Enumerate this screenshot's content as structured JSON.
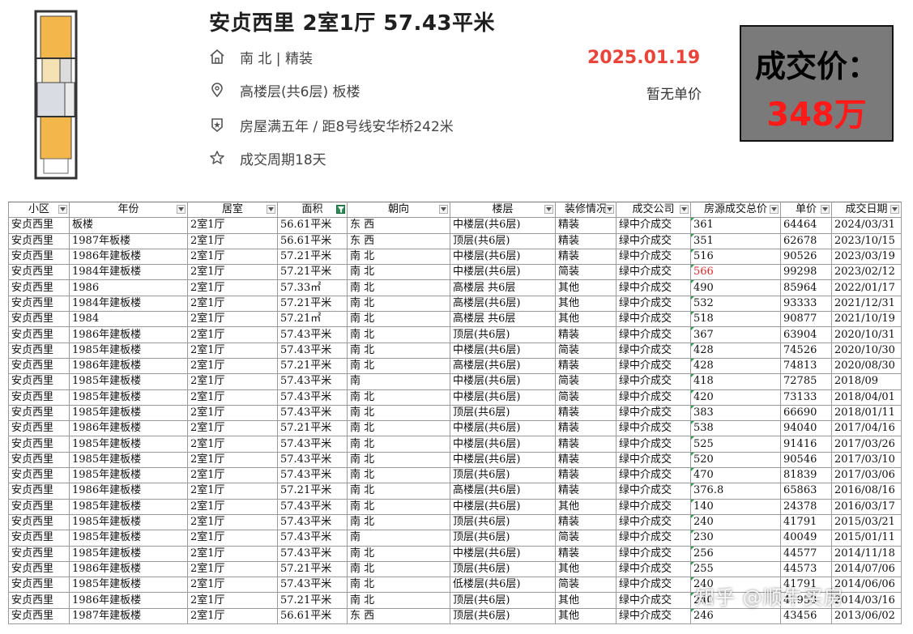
{
  "listing": {
    "title": "安贞西里 2室1厅 57.43平米",
    "orientation_decor": "南 北 | 精装",
    "floor_info": "高楼层(共6层) 板楼",
    "tags": "房屋满五年 / 距8号线安华桥242米",
    "cycle": "成交周期18天",
    "deal_date": "2025.01.19",
    "unit_note": "暂无单价",
    "price_label": "成交价：",
    "price_value": "348万",
    "icons": [
      "home-icon",
      "location-pin-icon",
      "shield-tag-icon",
      "star-icon"
    ],
    "colors": {
      "date": "#e8443a",
      "price_value": "#ff1a1a",
      "price_box_bg": "#7a7a7a",
      "filter_active": "#2e8b57"
    }
  },
  "sheet": {
    "headers": [
      "小区",
      "年份",
      "居室",
      "面积",
      "朝向",
      "楼层",
      "装修情况",
      "成交公司",
      "房源成交总价",
      "单价",
      "成交日期"
    ],
    "active_filter_column": "面积",
    "rows": [
      [
        "安贞西里",
        "板楼",
        "2室1厅",
        "56.61平米",
        "东 西",
        "中楼层(共6层)",
        "精装",
        "绿中介成交",
        "361",
        "64464",
        "2024/03/31"
      ],
      [
        "安贞西里",
        "1987年板楼",
        "2室1厅",
        "56.61平米",
        "东 西",
        "顶层(共6层)",
        "精装",
        "绿中介成交",
        "351",
        "62678",
        "2023/10/15"
      ],
      [
        "安贞西里",
        "1986年建板楼",
        "2室1厅",
        "57.21平米",
        "南 北",
        "中楼层(共6层)",
        "精装",
        "绿中介成交",
        "516",
        "90526",
        "2023/03/19"
      ],
      [
        "安贞西里",
        "1984年建板楼",
        "2室1厅",
        "57.21平米",
        "南 北",
        "中楼层(共6层)",
        "简装",
        "绿中介成交",
        "566",
        "99298",
        "2023/02/12"
      ],
      [
        "安贞西里",
        "1986",
        "2室1厅",
        "57.33㎡",
        "南 北",
        "高楼层 共6层",
        "其他",
        "绿中介成交",
        "490",
        "85964",
        "2022/01/17"
      ],
      [
        "安贞西里",
        "1984年建板楼",
        "2室1厅",
        "57.21平米",
        "南 北",
        "高楼层(共6层)",
        "其他",
        "绿中介成交",
        "532",
        "93333",
        "2021/12/31"
      ],
      [
        "安贞西里",
        "1984",
        "2室1厅",
        "57.21㎡",
        "南 北",
        "高楼层 共6层",
        "其他",
        "绿中介成交",
        "518",
        "90877",
        "2021/10/19"
      ],
      [
        "安贞西里",
        "1986年建板楼",
        "2室1厅",
        "57.43平米",
        "南 北",
        "顶层(共6层)",
        "精装",
        "绿中介成交",
        "367",
        "63904",
        "2020/10/31"
      ],
      [
        "安贞西里",
        "1985年建板楼",
        "2室1厅",
        "57.43平米",
        "南 北",
        "中楼层(共6层)",
        "简装",
        "绿中介成交",
        "428",
        "74526",
        "2020/10/30"
      ],
      [
        "安贞西里",
        "1986年建板楼",
        "2室1厅",
        "57.21平米",
        "南 北",
        "高楼层(共6层)",
        "精装",
        "绿中介成交",
        "428",
        "74813",
        "2020/08/30"
      ],
      [
        "安贞西里",
        "1985年建板楼",
        "2室1厅",
        "57.43平米",
        "南",
        "中楼层(共6层)",
        "简装",
        "绿中介成交",
        "418",
        "72785",
        "2018/09"
      ],
      [
        "安贞西里",
        "1985年建板楼",
        "2室1厅",
        "57.43平米",
        "南 北",
        "中楼层(共6层)",
        "简装",
        "绿中介成交",
        "420",
        "73133",
        "2018/04/01"
      ],
      [
        "安贞西里",
        "1985年建板楼",
        "2室1厅",
        "57.43平米",
        "南 北",
        "顶层(共6层)",
        "精装",
        "绿中介成交",
        "383",
        "66690",
        "2018/01/11"
      ],
      [
        "安贞西里",
        "1986年建板楼",
        "2室1厅",
        "57.21平米",
        "南 北",
        "中楼层(共6层)",
        "精装",
        "绿中介成交",
        "538",
        "94040",
        "2017/04/16"
      ],
      [
        "安贞西里",
        "1985年建板楼",
        "2室1厅",
        "57.43平米",
        "南 北",
        "中楼层(共6层)",
        "精装",
        "绿中介成交",
        "525",
        "91416",
        "2017/03/26"
      ],
      [
        "安贞西里",
        "1985年建板楼",
        "2室1厅",
        "57.43平米",
        "南 北",
        "中楼层(共6层)",
        "精装",
        "绿中介成交",
        "520",
        "90546",
        "2017/03/10"
      ],
      [
        "安贞西里",
        "1985年建板楼",
        "2室1厅",
        "57.43平米",
        "南 北",
        "顶层(共6层)",
        "精装",
        "绿中介成交",
        "470",
        "81839",
        "2017/03/06"
      ],
      [
        "安贞西里",
        "1986年建板楼",
        "2室1厅",
        "57.21平米",
        "南 北",
        "高楼层(共6层)",
        "精装",
        "绿中介成交",
        "376.8",
        "65863",
        "2016/08/16"
      ],
      [
        "安贞西里",
        "1985年建板楼",
        "2室1厅",
        "57.43平米",
        "南 北",
        "中楼层(共6层)",
        "其他",
        "绿中介成交",
        "140",
        "24378",
        "2016/03/17"
      ],
      [
        "安贞西里",
        "1985年建板楼",
        "2室1厅",
        "57.43平米",
        "南 北",
        "顶层(共6层)",
        "精装",
        "绿中介成交",
        "240",
        "41791",
        "2015/03/21"
      ],
      [
        "安贞西里",
        "1985年建板楼",
        "2室1厅",
        "57.43平米",
        "南",
        "顶层(共6层)",
        "简装",
        "绿中介成交",
        "230",
        "40049",
        "2015/01/11"
      ],
      [
        "安贞西里",
        "1985年建板楼",
        "2室1厅",
        "57.43平米",
        "南 北",
        "中楼层(共6层)",
        "精装",
        "绿中介成交",
        "256",
        "44577",
        "2014/11/18"
      ],
      [
        "安贞西里",
        "1986年建板楼",
        "2室1厅",
        "57.21平米",
        "南 北",
        "顶层(共6层)",
        "其他",
        "绿中介成交",
        "255",
        "44573",
        "2014/07/06"
      ],
      [
        "安贞西里",
        "1985年建板楼",
        "2室1厅",
        "57.43平米",
        "南 北",
        "低楼层(共6层)",
        "简装",
        "绿中介成交",
        "240",
        "41791",
        "2014/06/06"
      ],
      [
        "安贞西里",
        "1986年建板楼",
        "2室1厅",
        "57.21平米",
        "南 北",
        "顶层(共6层)",
        "其他",
        "绿中介成交",
        "240",
        "41953",
        "2014/03/16"
      ],
      [
        "安贞西里",
        "1987年建板楼",
        "2室1厅",
        "56.61平米",
        "东 西",
        "顶层(共6层)",
        "其他",
        "绿中介成交",
        "246",
        "43456",
        "2013/06/02"
      ]
    ],
    "highlighted_cell": {
      "row": 3,
      "col": 8,
      "color": "#e0262b"
    }
  },
  "watermark": "知乎 @顺牛买房"
}
